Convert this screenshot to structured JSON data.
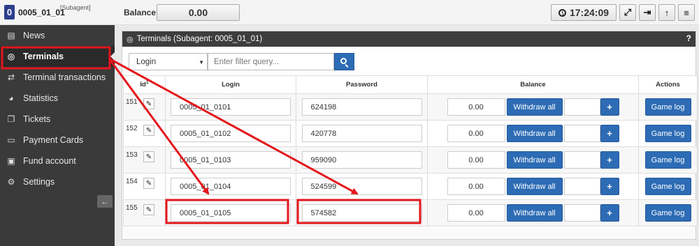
{
  "header": {
    "badge": "0",
    "account": "0005_01_01",
    "role": "[Subagent]",
    "balance_label": "Balance:",
    "balance_value": "0.00",
    "clock": "17:24:09",
    "icons": [
      "expand-icon",
      "logout-icon",
      "arrow-up-icon",
      "menu-icon"
    ]
  },
  "sidebar": {
    "items": [
      {
        "label": "News",
        "icon": "newspaper-icon"
      },
      {
        "label": "Terminals",
        "icon": "gamepad-icon"
      },
      {
        "label": "Terminal transactions",
        "icon": "exchange-icon"
      },
      {
        "label": "Statistics",
        "icon": "pie-chart-icon"
      },
      {
        "label": "Tickets",
        "icon": "inbox-icon"
      },
      {
        "label": "Payment Cards",
        "icon": "credit-card-icon"
      },
      {
        "label": "Fund account",
        "icon": "money-icon"
      },
      {
        "label": "Settings",
        "icon": "cogs-icon"
      }
    ],
    "active": "Terminals"
  },
  "panel": {
    "title": "Terminals (Subagent: 0005_01_01)",
    "help": "?",
    "filter": {
      "field": "Login",
      "placeholder": "Enter filter query..."
    }
  },
  "table": {
    "headers": {
      "id": "Id",
      "id_sort": "1",
      "login": "Login",
      "password": "Password",
      "balance": "Balance",
      "actions": "Actions"
    },
    "withdraw_label": "Withdraw all",
    "plus_label": "+",
    "gamelog_label": "Game log",
    "rows": [
      {
        "id": "151",
        "login": "0005_01_0101",
        "password": "624198",
        "balance": "0.00"
      },
      {
        "id": "152",
        "login": "0005_01_0102",
        "password": "420778",
        "balance": "0.00"
      },
      {
        "id": "153",
        "login": "0005_01_0103",
        "password": "959090",
        "balance": "0.00"
      },
      {
        "id": "154",
        "login": "0005_01_0104",
        "password": "524599",
        "balance": "0.00"
      },
      {
        "id": "155",
        "login": "0005_01_0105",
        "password": "574582",
        "balance": "0.00"
      }
    ]
  },
  "colors": {
    "accent": "#2d6cb5",
    "annotation": "#e3161c",
    "sidebar": "#3a3a3a"
  }
}
